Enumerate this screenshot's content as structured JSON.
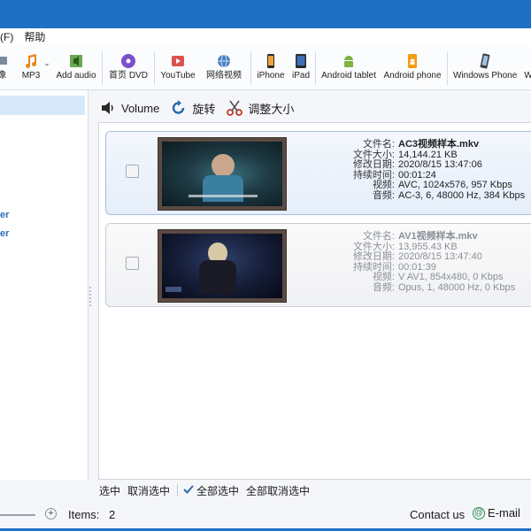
{
  "menu": {
    "items": [
      "(F)",
      "帮助"
    ]
  },
  "toolbar": {
    "items": [
      {
        "label": "像",
        "icon": "video-icon"
      },
      {
        "label": "MP3",
        "icon": "music-note-icon"
      },
      {
        "label": "Add audio",
        "icon": "add-audio-icon"
      },
      {
        "label": "首页 DVD",
        "icon": "dvd-disc-icon"
      },
      {
        "label": "YouTube",
        "icon": "youtube-icon"
      },
      {
        "label": "网络视频",
        "icon": "globe-icon"
      },
      {
        "label": "iPhone",
        "icon": "iphone-icon"
      },
      {
        "label": "iPad",
        "icon": "ipad-icon"
      },
      {
        "label": "Android tablet",
        "icon": "android-icon"
      },
      {
        "label": "Android phone",
        "icon": "android-phone-icon"
      },
      {
        "label": "Windows Phone",
        "icon": "windows-phone-icon"
      },
      {
        "label": "W",
        "icon": ""
      }
    ]
  },
  "sidebar": {
    "items": [
      "er",
      "er"
    ]
  },
  "actions": {
    "volume": "Volume",
    "rotate": "旋转",
    "resize": "调整大小"
  },
  "labels": {
    "name": "文件名:",
    "size": "文件大小:",
    "modified": "修改日期:",
    "duration": "持续时间:",
    "video": "视频:",
    "audio": "音频:"
  },
  "files": [
    {
      "name": "AC3视频样本.mkv",
      "size": "14,144.21 KB",
      "modified": "2020/8/15 13:47:06",
      "duration": "00:01:24",
      "video": "AVC, 1024x576, 957 Kbps",
      "audio": "AC-3, 6, 48000 Hz, 384 Kbps"
    },
    {
      "name": "AV1视频样本.mkv",
      "size": "13,955.43 KB",
      "modified": "2020/8/15 13:47:40",
      "duration": "00:01:39",
      "video": "V  AV1, 854x480, 0 Kbps",
      "audio": "Opus, 1, 48000 Hz, 0 Kbps"
    }
  ],
  "bottombar": {
    "select": "选中",
    "deselect": "取消选中",
    "select_all": "全部选中",
    "deselect_all": "全部取消选中"
  },
  "status": {
    "items_label": "Items:",
    "items_count": "2",
    "contact": "Contact us",
    "email": "E-mail"
  },
  "colors": {
    "accent": "#1f6fc4",
    "selection": "#d7e8fb",
    "link": "#2d6db8"
  }
}
